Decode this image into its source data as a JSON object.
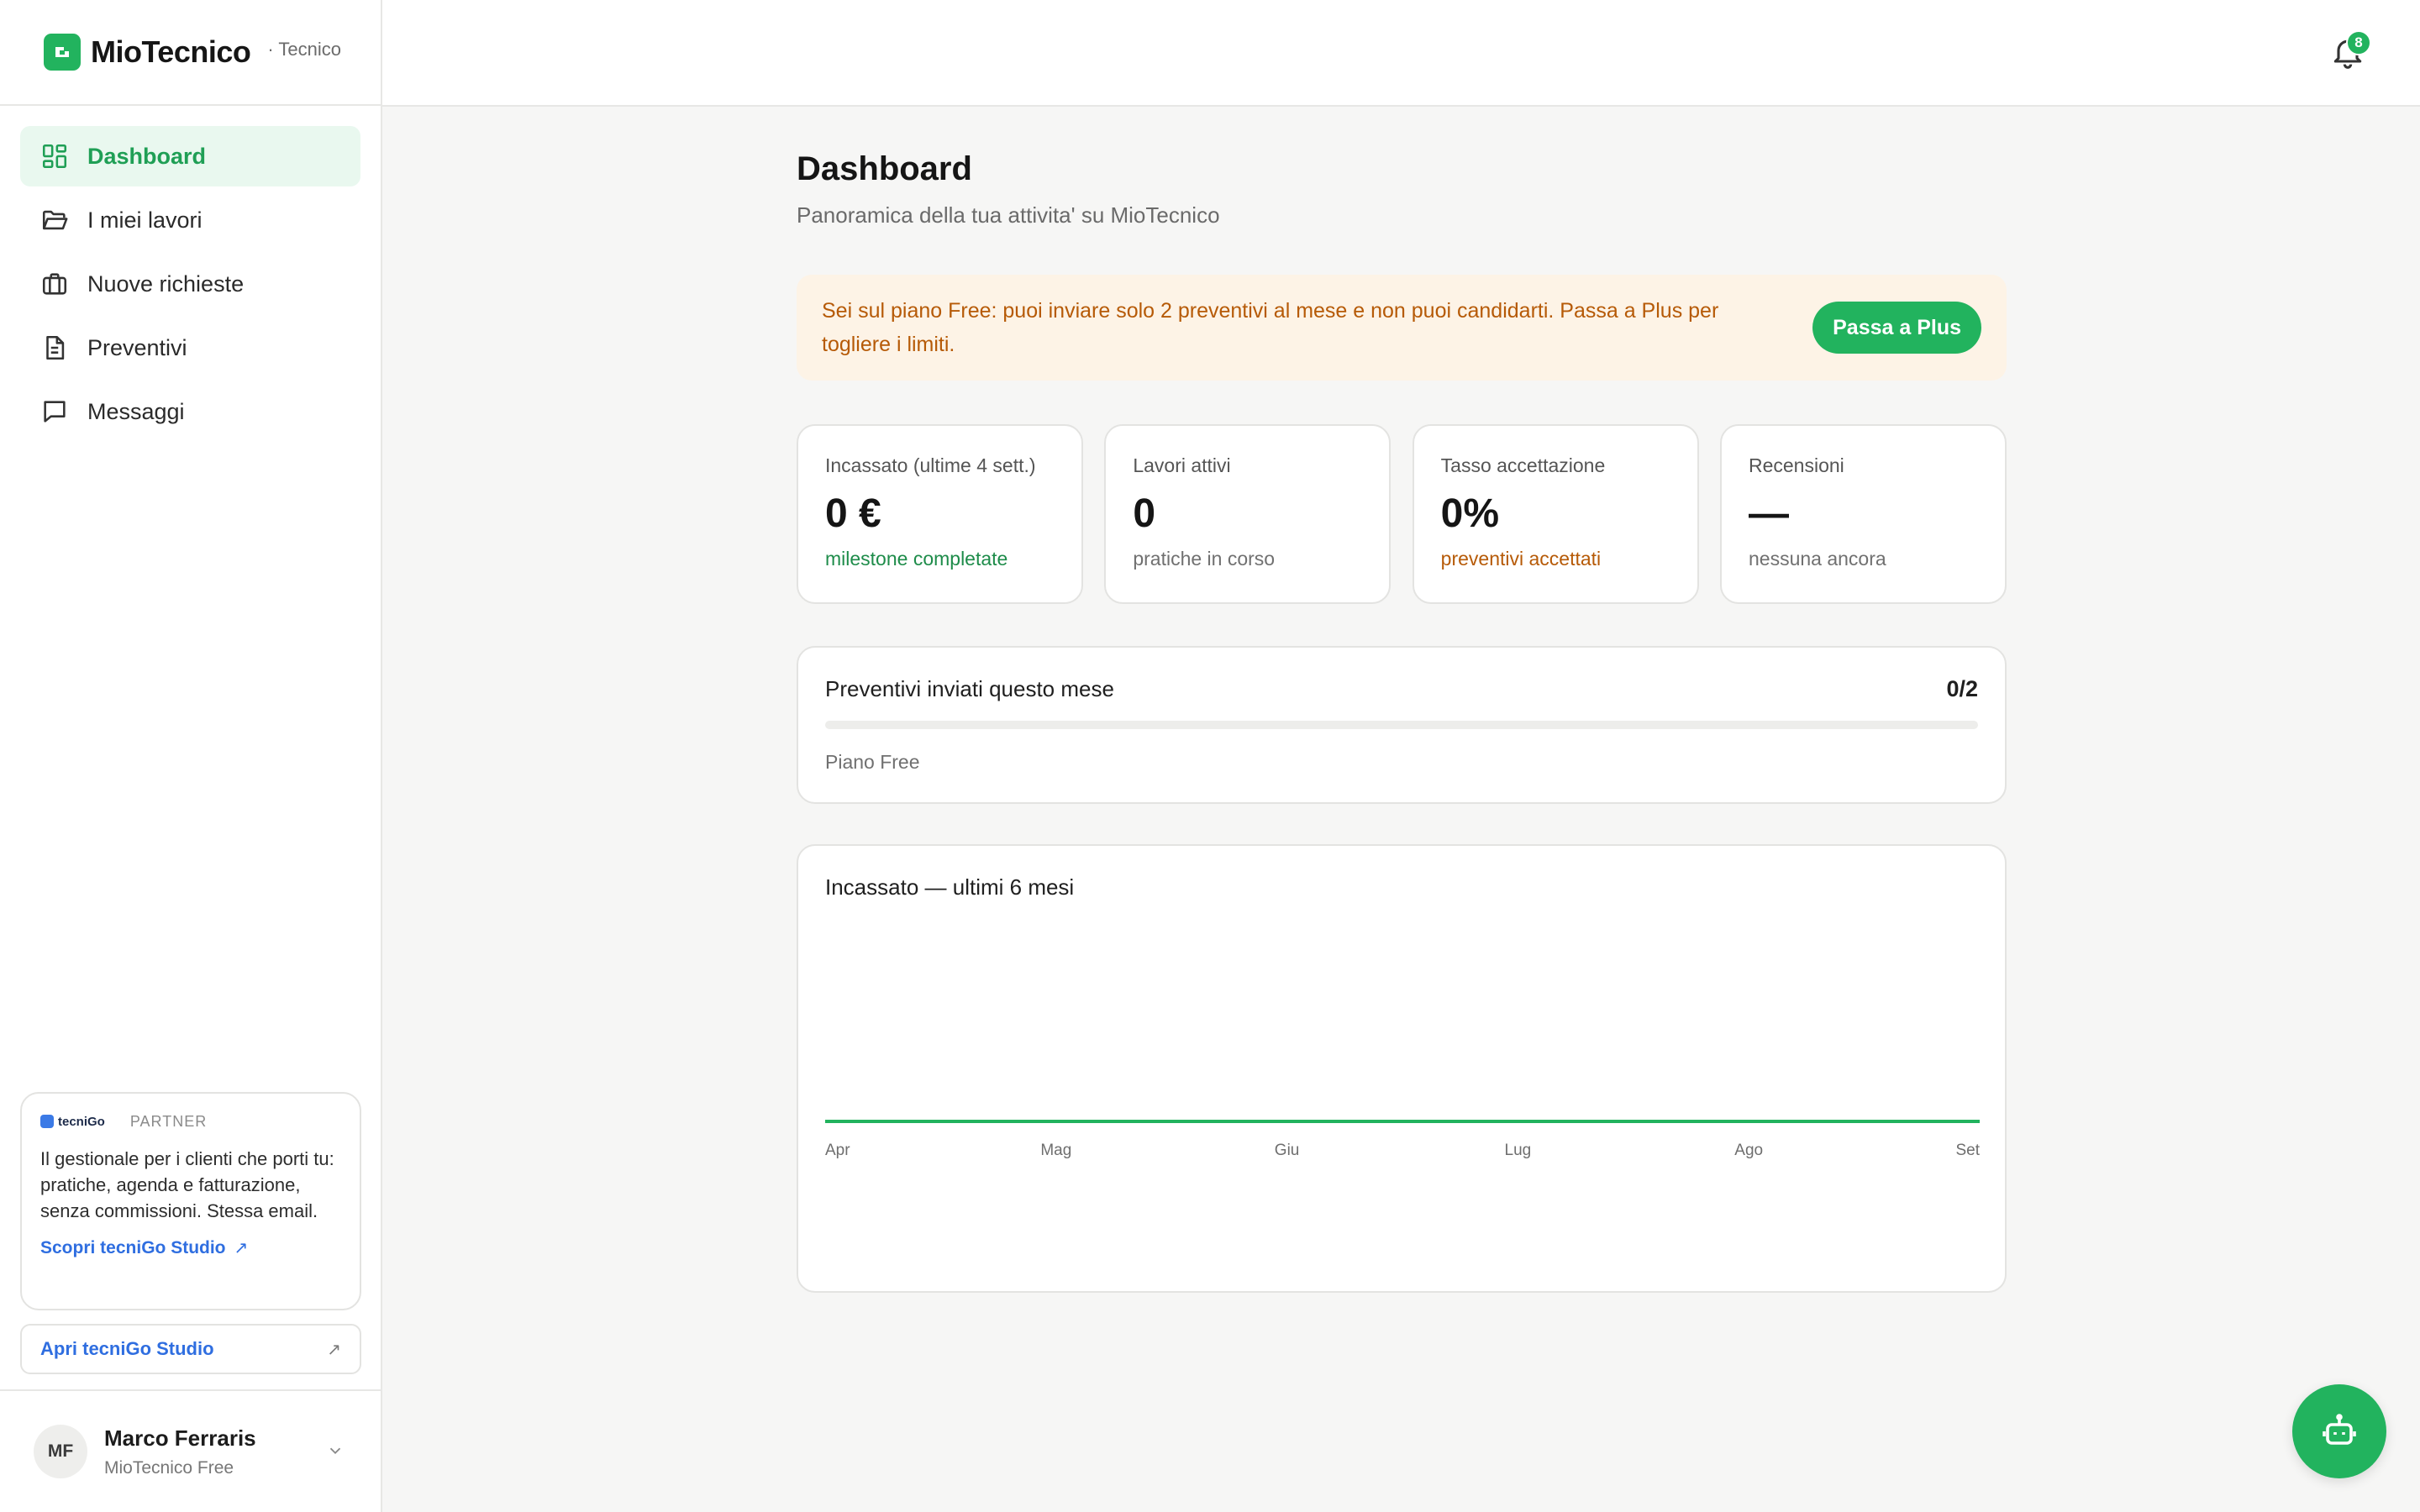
{
  "brand": {
    "name": "MioTecnico",
    "role": "· Tecnico",
    "accent": "#22b35e"
  },
  "sidebar": {
    "items": [
      {
        "label": "Dashboard",
        "icon": "dashboard-grid-icon",
        "active": true
      },
      {
        "label": "I miei lavori",
        "icon": "folder-open-icon",
        "active": false
      },
      {
        "label": "Nuove richieste",
        "icon": "briefcase-icon",
        "active": false
      },
      {
        "label": "Preventivi",
        "icon": "document-icon",
        "active": false
      },
      {
        "label": "Messaggi",
        "icon": "chat-bubble-icon",
        "active": false
      }
    ],
    "partner": {
      "logo_text": "tecniGo",
      "tag": "PARTNER",
      "text": "Il gestionale per i clienti che porti tu: pratiche, agenda e fatturazione, senza commissioni. Stessa email.",
      "link_label": "Scopri tecniGo Studio"
    },
    "studio_button": "Apri tecniGo Studio",
    "user": {
      "initials": "MF",
      "name": "Marco Ferraris",
      "plan": "MioTecnico Free"
    }
  },
  "topbar": {
    "notifications_count": "8"
  },
  "main": {
    "title": "Dashboard",
    "subtitle": "Panoramica della tua attivita' su MioTecnico",
    "banner": {
      "text": "Sei sul piano Free: puoi inviare solo 2 preventivi al mese e non puoi candidarti. Passa a Plus per togliere i limiti.",
      "button": "Passa a Plus"
    },
    "stats": [
      {
        "label": "Incassato (ultime 4 sett.)",
        "value": "0 €",
        "note": "milestone completate",
        "note_color": "green"
      },
      {
        "label": "Lavori attivi",
        "value": "0",
        "note": "pratiche in corso",
        "note_color": "gray"
      },
      {
        "label": "Tasso accettazione",
        "value": "0%",
        "note": "preventivi accettati",
        "note_color": "orange"
      },
      {
        "label": "Recensioni",
        "value": "—",
        "note": "nessuna ancora",
        "note_color": "gray"
      }
    ],
    "quota": {
      "title": "Preventivi inviati questo mese",
      "count": "0/2",
      "used": 0,
      "limit": 2,
      "plan": "Piano Free"
    },
    "chart": {
      "title": "Incassato — ultimi 6 mesi"
    }
  },
  "chart_data": {
    "type": "area",
    "title": "Incassato — ultimi 6 mesi",
    "categories": [
      "Apr",
      "Mag",
      "Giu",
      "Lug",
      "Ago",
      "Set"
    ],
    "values": [
      0,
      0,
      0,
      0,
      0,
      0
    ],
    "color": "#22b35e",
    "grid": false
  }
}
